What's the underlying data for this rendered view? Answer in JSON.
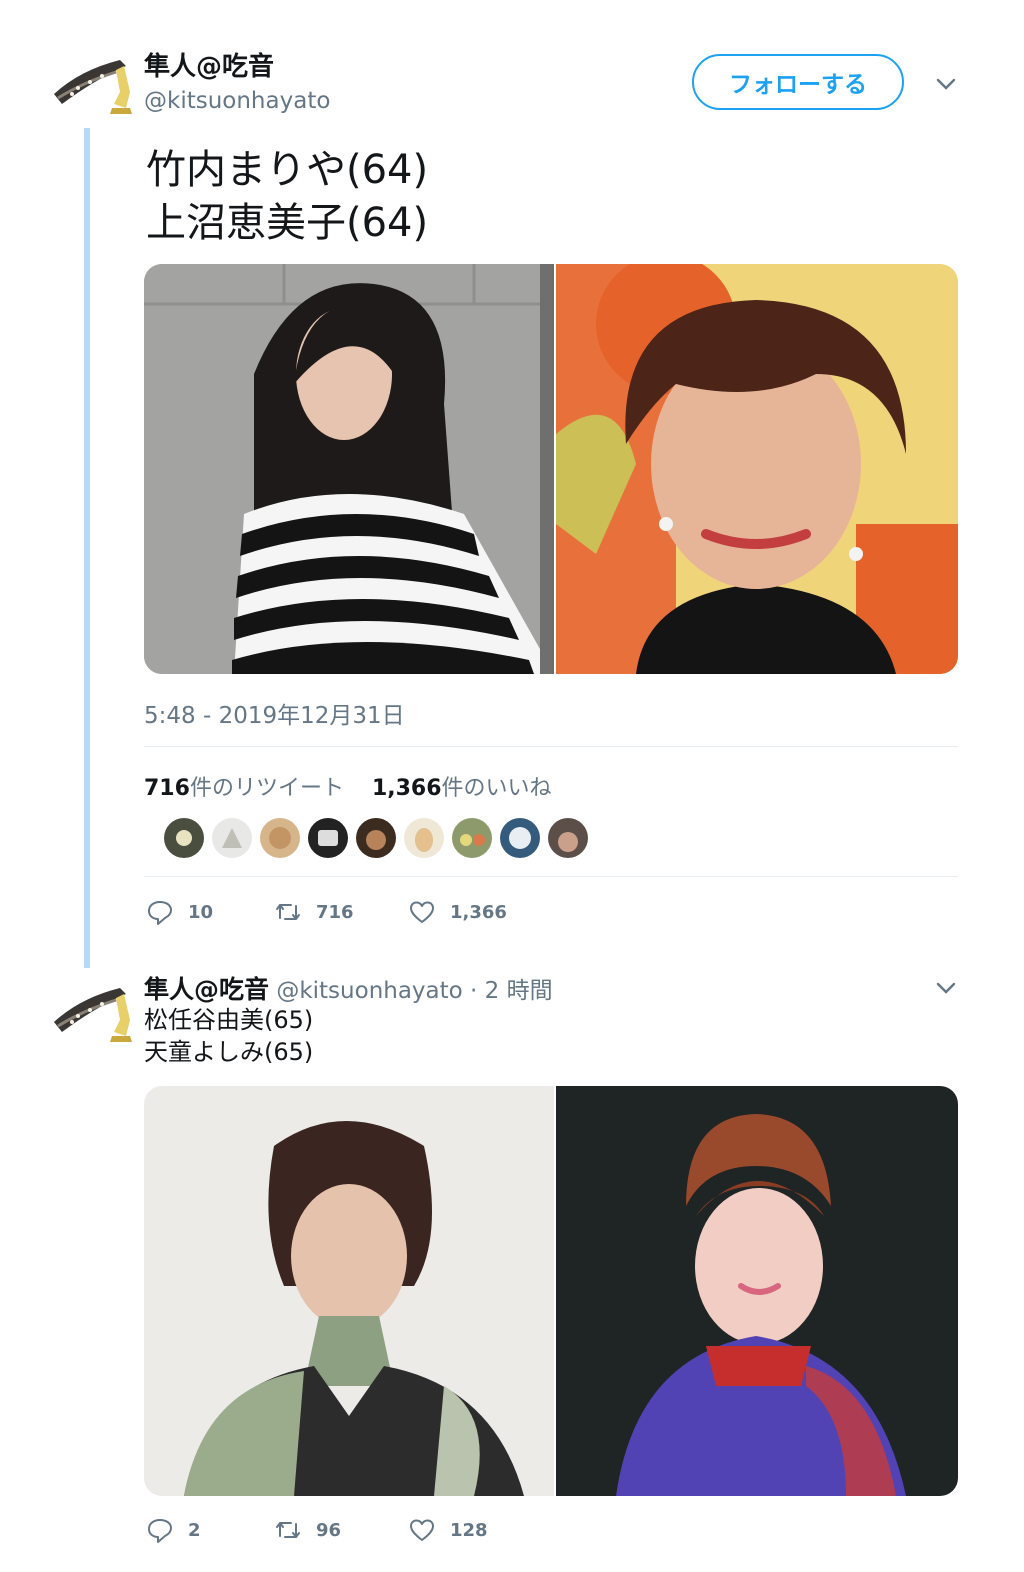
{
  "tweet1": {
    "author_name": "隼人@吃音",
    "author_handle": "@kitsuonhayato",
    "follow_label": "フォローする",
    "lines": [
      "竹内まりや(64)",
      "上沼恵美子(64)"
    ],
    "timestamp": "5:48 - 2019年12月31日",
    "retweet_count": "716",
    "retweet_label": "件のリツイート",
    "like_count": "1,366",
    "like_label": "件のいいね",
    "actions": {
      "reply": "10",
      "retweet": "716",
      "like": "1,366"
    },
    "media": [
      "photo-woman-striped-shirt",
      "photo-woman-short-hair-smiling"
    ]
  },
  "tweet2": {
    "author_name": "隼人@吃音",
    "author_handle": "@kitsuonhayato",
    "time": "· 2 時間",
    "lines": [
      "松任谷由美(65)",
      "天童よしみ(65)"
    ],
    "actions": {
      "reply": "2",
      "retweet": "96",
      "like": "128"
    },
    "media": [
      "photo-woman-green-jacket",
      "photo-woman-purple-dress"
    ]
  },
  "colors": {
    "accent": "#1da1f2",
    "thread_line": "#b5d9f7",
    "muted": "#657786"
  },
  "icons": [
    "reply-icon",
    "retweet-icon",
    "like-icon",
    "chevron-down-icon"
  ]
}
